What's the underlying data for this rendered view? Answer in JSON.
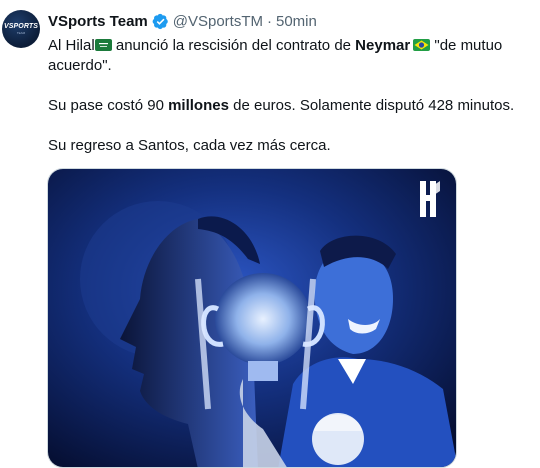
{
  "tweet": {
    "author": {
      "display_name": "VSports Team",
      "handle": "@VSportsTM",
      "avatar_text": "VSPORTS",
      "avatar_subtext": "TEAM",
      "verified": true
    },
    "separator": "·",
    "timestamp": "50min",
    "text": {
      "p1_a": "Al Hilal",
      "p1_b": " anunció la rescisión del contrato de ",
      "p1_bold": "Neymar",
      "p1_c": " \"de mutuo acuerdo\".",
      "p2_a": "Su pase costó 90 ",
      "p2_bold": "millones",
      "p2_b": " de euros. Solamente disputó 428 minutos.",
      "p3": "Su regreso a Santos, cada vez más cerca."
    },
    "flags": [
      "saudi-arabia-flag",
      "brazil-flag"
    ],
    "media": {
      "logo": "al-hilal-logo",
      "description_icons": [
        "player-profile",
        "trophy",
        "player-smiling"
      ]
    }
  },
  "colors": {
    "text": "#0f1419",
    "secondary": "#536471",
    "verified": "#1d9bf0",
    "media_bg": "#0a1a4a"
  }
}
